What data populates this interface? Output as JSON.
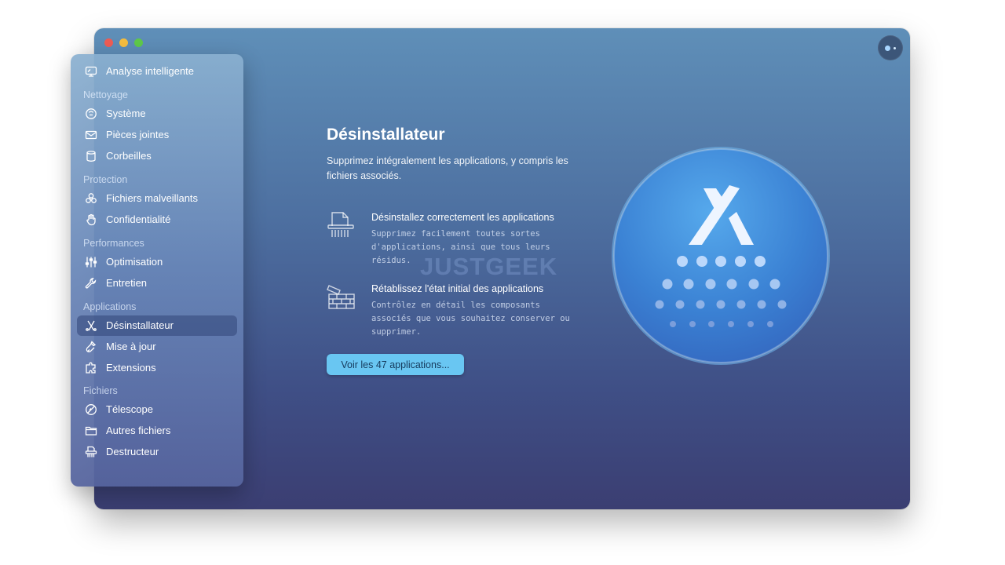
{
  "window": {
    "traffic_lights": [
      "close",
      "minimize",
      "zoom"
    ],
    "assistant_icon": "assistant-dots-icon"
  },
  "sidebar": {
    "smart_scan": {
      "label": "Analyse intelligente",
      "icon": "monitor-icon"
    },
    "sections": [
      {
        "title": "Nettoyage",
        "items": [
          {
            "label": "Système",
            "icon": "system-junk-icon"
          },
          {
            "label": "Pièces jointes",
            "icon": "mail-icon"
          },
          {
            "label": "Corbeilles",
            "icon": "trash-bin-icon"
          }
        ]
      },
      {
        "title": "Protection",
        "items": [
          {
            "label": "Fichiers malveillants",
            "icon": "biohazard-icon"
          },
          {
            "label": "Confidentialité",
            "icon": "hand-icon"
          }
        ]
      },
      {
        "title": "Performances",
        "items": [
          {
            "label": "Optimisation",
            "icon": "sliders-icon"
          },
          {
            "label": "Entretien",
            "icon": "wrench-icon"
          }
        ]
      },
      {
        "title": "Applications",
        "items": [
          {
            "label": "Désinstallateur",
            "icon": "uninstaller-icon",
            "active": true
          },
          {
            "label": "Mise à jour",
            "icon": "updater-icon"
          },
          {
            "label": "Extensions",
            "icon": "extensions-icon"
          }
        ]
      },
      {
        "title": "Fichiers",
        "items": [
          {
            "label": "Télescope",
            "icon": "lens-icon"
          },
          {
            "label": "Autres fichiers",
            "icon": "folder-icon"
          },
          {
            "label": "Destructeur",
            "icon": "shredder-icon"
          }
        ]
      }
    ]
  },
  "main": {
    "title": "Désinstallateur",
    "description": "Supprimez intégralement les applications, y compris les fichiers associés.",
    "features": [
      {
        "icon": "shred-document-icon",
        "title": "Désinstallez correctement les applications",
        "description": "Supprimez facilement toutes sortes d'applications, ainsi que tous leurs résidus."
      },
      {
        "icon": "reset-bricks-icon",
        "title": "Rétablissez l'état initial des applications",
        "description": "Contrôlez en détail les composants associés que vous souhaitez conserver ou supprimer."
      }
    ],
    "button_label": "Voir les 47 applications...",
    "watermark": "JUSTGEEK"
  },
  "colors": {
    "accent_button": "#69c6f2",
    "sidebar_active": "#3a4f86",
    "hero_circle": "#3f86d6"
  }
}
